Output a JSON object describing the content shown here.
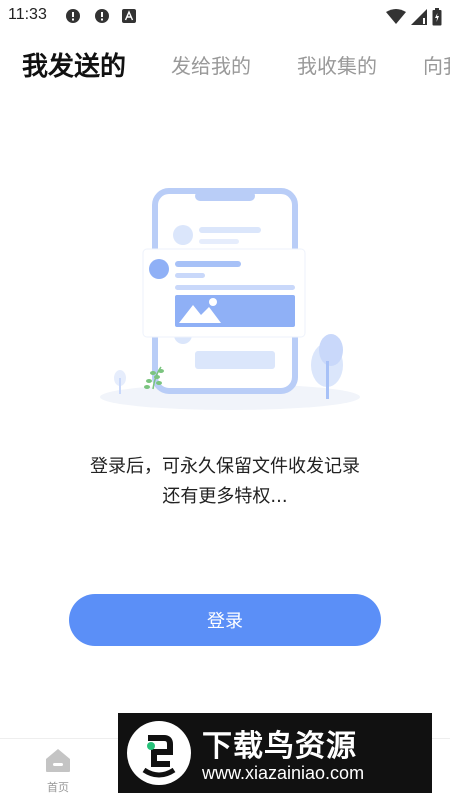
{
  "status_bar": {
    "time": "11:33",
    "left_icons": [
      "alert-icon",
      "alert-icon",
      "a-icon"
    ],
    "right_icons": [
      "wifi-icon",
      "signal-icon",
      "battery-icon"
    ]
  },
  "tabs": [
    {
      "label": "我发送的",
      "active": true
    },
    {
      "label": "发给我的",
      "active": false
    },
    {
      "label": "我收集的",
      "active": false
    },
    {
      "label": "向我",
      "active": false
    }
  ],
  "empty_state": {
    "line1": "登录后，可永久保留文件收发记录",
    "line2": "还有更多特权..."
  },
  "login_button": "登录",
  "bottom_nav": {
    "home_label": "首页"
  },
  "watermark": {
    "title": "下载鸟资源",
    "url": "www.xiazainiao.com"
  },
  "colors": {
    "accent": "#5b8ff7",
    "illustration_light": "#dbe6fb",
    "illustration_mid": "#b9cdf7"
  }
}
